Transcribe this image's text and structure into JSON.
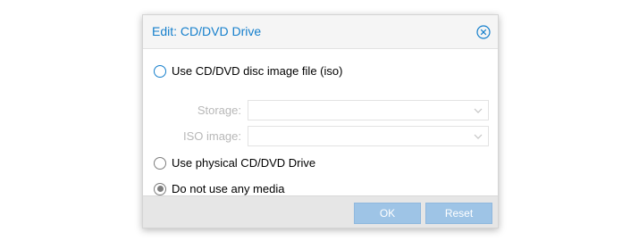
{
  "dialog": {
    "title": "Edit: CD/DVD Drive",
    "close_icon": "close-circle-icon"
  },
  "options": {
    "iso": {
      "label": "Use CD/DVD disc image file (iso)",
      "checked": false,
      "focused": true
    },
    "storage": {
      "label": "Storage:",
      "value": "",
      "disabled": true
    },
    "iso_image": {
      "label": "ISO image:",
      "value": "",
      "disabled": true
    },
    "physical": {
      "label": "Use physical CD/DVD Drive",
      "checked": false
    },
    "no_media": {
      "label": "Do not use any media",
      "checked": true
    }
  },
  "footer": {
    "ok_label": "OK",
    "reset_label": "Reset",
    "ok_disabled": true,
    "reset_disabled": true
  },
  "colors": {
    "accent": "#157fcc",
    "button_disabled": "#9ec4e6",
    "footer_bg": "#e6e6e6"
  }
}
